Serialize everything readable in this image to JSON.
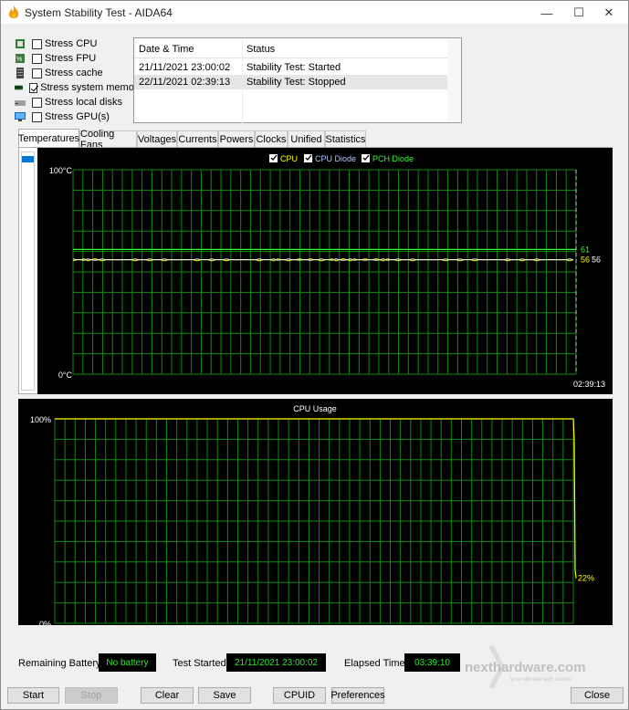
{
  "window": {
    "title": "System Stability Test - AIDA64",
    "minimize_glyph": "—",
    "maximize_glyph": "☐",
    "close_glyph": "✕"
  },
  "stress_options": [
    {
      "label": "Stress CPU",
      "checked": false,
      "icon": "cpu-chip-icon"
    },
    {
      "label": "Stress FPU",
      "checked": false,
      "icon": "fpu-icon"
    },
    {
      "label": "Stress cache",
      "checked": false,
      "icon": "cache-icon"
    },
    {
      "label": "Stress system memory",
      "checked": true,
      "icon": "memory-icon"
    },
    {
      "label": "Stress local disks",
      "checked": false,
      "icon": "disk-icon"
    },
    {
      "label": "Stress GPU(s)",
      "checked": false,
      "icon": "gpu-icon"
    }
  ],
  "log": {
    "columns": [
      "Date & Time",
      "Status"
    ],
    "rows": [
      {
        "time": "21/11/2021 23:00:02",
        "status": "Stability Test: Started"
      },
      {
        "time": "22/11/2021 02:39:13",
        "status": "Stability Test: Stopped"
      }
    ]
  },
  "tabs": [
    "Temperatures",
    "Cooling Fans",
    "Voltages",
    "Currents",
    "Powers",
    "Clocks",
    "Unified",
    "Statistics"
  ],
  "active_tab": "Temperatures",
  "temp_chart": {
    "type": "line",
    "legend": [
      {
        "name": "CPU",
        "color": "#ffff00"
      },
      {
        "name": "CPU Diode",
        "color": "#b0c8ff"
      },
      {
        "name": "PCH Diode",
        "color": "#33ff33"
      }
    ],
    "y_max_label": "100°C",
    "y_min_label": "0°C",
    "ylim": [
      0,
      100
    ],
    "time_label": "02:39:13",
    "pch_value": 61,
    "cpu_value": 56,
    "cpu_diode_value": 56,
    "value_labels": {
      "pch": "61",
      "cpu": "56",
      "cpu_diode": "56"
    },
    "pch_color": "#33ff33",
    "cpu_color": "#ffff00",
    "cpu_diode_color": "#ffffff"
  },
  "cpu_chart": {
    "type": "line",
    "title": "CPU Usage",
    "y_max_label": "100%",
    "y_min_label": "0%",
    "ylim": [
      0,
      100
    ],
    "steady_value": 100,
    "final_value": 22,
    "final_label": "22%",
    "line_color": "#ffff00"
  },
  "status": {
    "remaining_battery_label": "Remaining Battery:",
    "remaining_battery_value": "No battery",
    "test_started_label": "Test Started:",
    "test_started_value": "21/11/2021 23:00:02",
    "elapsed_label": "Elapsed Time:",
    "elapsed_value": "03:39:10"
  },
  "buttons": {
    "start": "Start",
    "stop": "Stop",
    "clear": "Clear",
    "save": "Save",
    "cpuid": "CPUID",
    "preferences": "Preferences",
    "close": "Close"
  },
  "watermark": {
    "brand": "nexthardware.com",
    "tagline": "your ultimate tech source"
  },
  "colors": {
    "grid": "#0f8a0f",
    "graph_bg": "#000000",
    "accent_select": "#0078d7",
    "status_text": "#2ee62e"
  }
}
